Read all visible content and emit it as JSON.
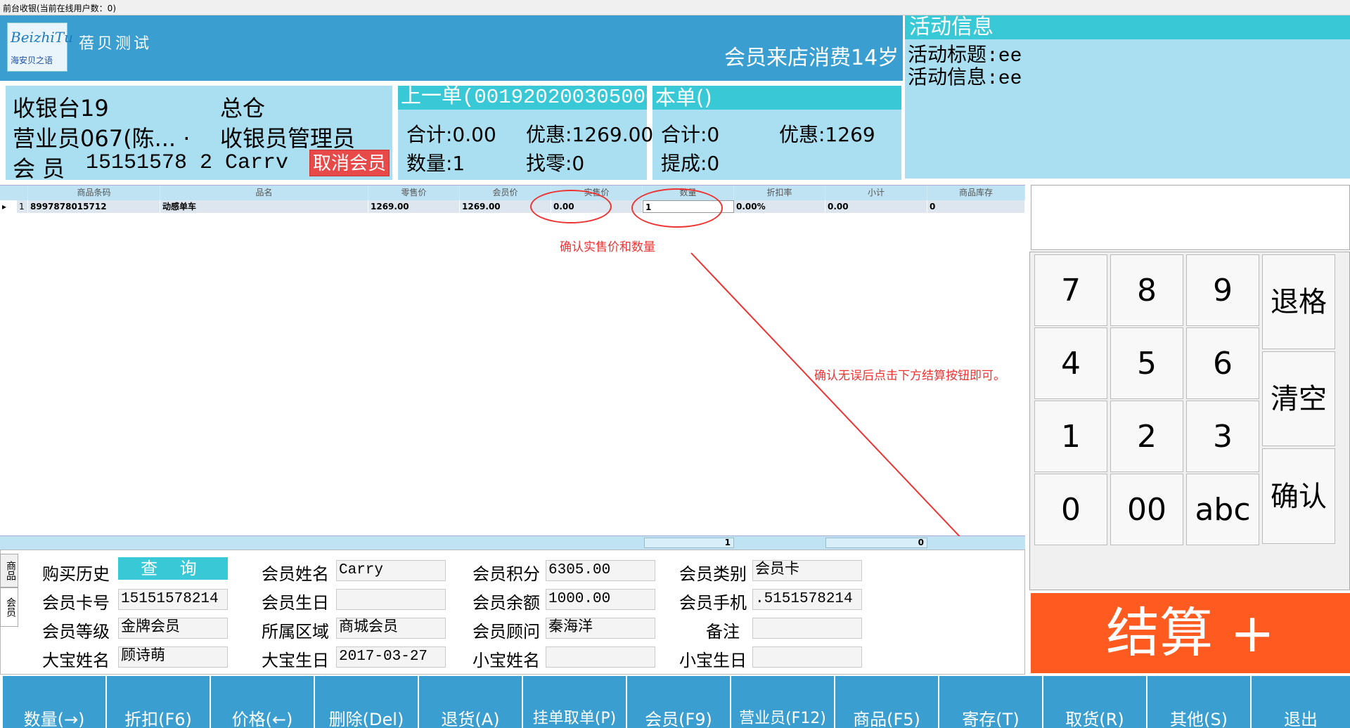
{
  "window": {
    "title": "前台收银(当前在线用户数：0)"
  },
  "header": {
    "logo_text": "BeizhiTu",
    "logo_sub": "海安贝之语",
    "store_name": "蓓贝测试",
    "marquee": "会员来店消费14岁"
  },
  "activity": {
    "title": "活动信息",
    "line1": "活动标题:ee",
    "line2": "活动信息:ee"
  },
  "cashier": {
    "register": "收银台19",
    "warehouse": "总仓",
    "operator": "营业员067(陈... ·",
    "role": "收银员管理员",
    "member_prefix": "会  员",
    "member_value": "15151578 2 Carrv",
    "cancel_member": "取消会员"
  },
  "last_order": {
    "title": "上一单(001920200305000",
    "total": "合计:0.00",
    "discount": "优惠:1269.00",
    "quantity": "数量:1",
    "change": "找零:0"
  },
  "current_order": {
    "title": "本单()",
    "total": "合计:0",
    "discount": "优惠:1269",
    "commission": "提成:0"
  },
  "grid": {
    "headers": [
      "商品条码",
      "品名",
      "零售价",
      "会员价",
      "实售价",
      "数量",
      "折扣率",
      "小计",
      "商品库存"
    ],
    "rows": [
      {
        "index": "1",
        "barcode": "8997878015712",
        "name": "动感单车",
        "retail": "1269.00",
        "member_price": "1269.00",
        "actual": "0.00",
        "qty": "1",
        "discount_rate": "0.00%",
        "subtotal": "0.00",
        "stock": "0"
      }
    ],
    "footer_qty": "1",
    "footer_total": "0"
  },
  "annotations": {
    "note1": "确认实售价和数量",
    "note2": "确认无误后点击下方结算按钮即可。"
  },
  "member": {
    "tab_product": "商品",
    "tab_member": "会员",
    "history_label": "购买历史",
    "query_button": "查 询",
    "card_label": "会员卡号",
    "card_value": "15151578214",
    "level_label": "会员等级",
    "level_value": "金牌会员",
    "child1_label": "大宝姓名",
    "child1_value": "顾诗萌",
    "name_label": "会员姓名",
    "name_value": "Carry",
    "birthday_label": "会员生日",
    "birthday_value": "",
    "region_label": "所属区域",
    "region_value": "商城会员",
    "child1_bday_label": "大宝生日",
    "child1_bday_value": "2017-03-27",
    "points_label": "会员积分",
    "points_value": "6305.00",
    "balance_label": "会员余额",
    "balance_value": "1000.00",
    "advisor_label": "会员顾问",
    "advisor_value": "秦海洋",
    "child2_label": "小宝姓名",
    "child2_value": "",
    "type_label": "会员类别",
    "type_value": "会员卡",
    "phone_label": "会员手机",
    "phone_value": ".5151578214",
    "note_label": "备注",
    "note_value": "",
    "child2_bday_label": "小宝生日",
    "child2_bday_value": ""
  },
  "keypad": {
    "k7": "7",
    "k8": "8",
    "k9": "9",
    "backspace": "退格",
    "k4": "4",
    "k5": "5",
    "k6": "6",
    "clear": "清空",
    "k1": "1",
    "k2": "2",
    "k3": "3",
    "confirm": "确认",
    "k0": "0",
    "k00": "00",
    "abc": "abc"
  },
  "checkout": {
    "label": "结算 +"
  },
  "toolbar": {
    "qty": "数量(→)",
    "discount": "折扣(F6)",
    "price": "价格(←)",
    "delete": "删除(Del)",
    "return": "退货(A)",
    "hold": "挂单取单(P)",
    "member": "会员(F9)",
    "salesperson": "营业员(F12)",
    "product": "商品(F5)",
    "deposit": "寄存(T)",
    "pickup": "取货(R)",
    "other": "其他(S)",
    "exit": "退出"
  },
  "colors": {
    "header": "#3a9fd0",
    "panel": "#a9dff0",
    "accent": "#39c9d6",
    "checkout": "#ff5a1f",
    "cancel": "#e84a4a",
    "annotation": "#e33333"
  }
}
